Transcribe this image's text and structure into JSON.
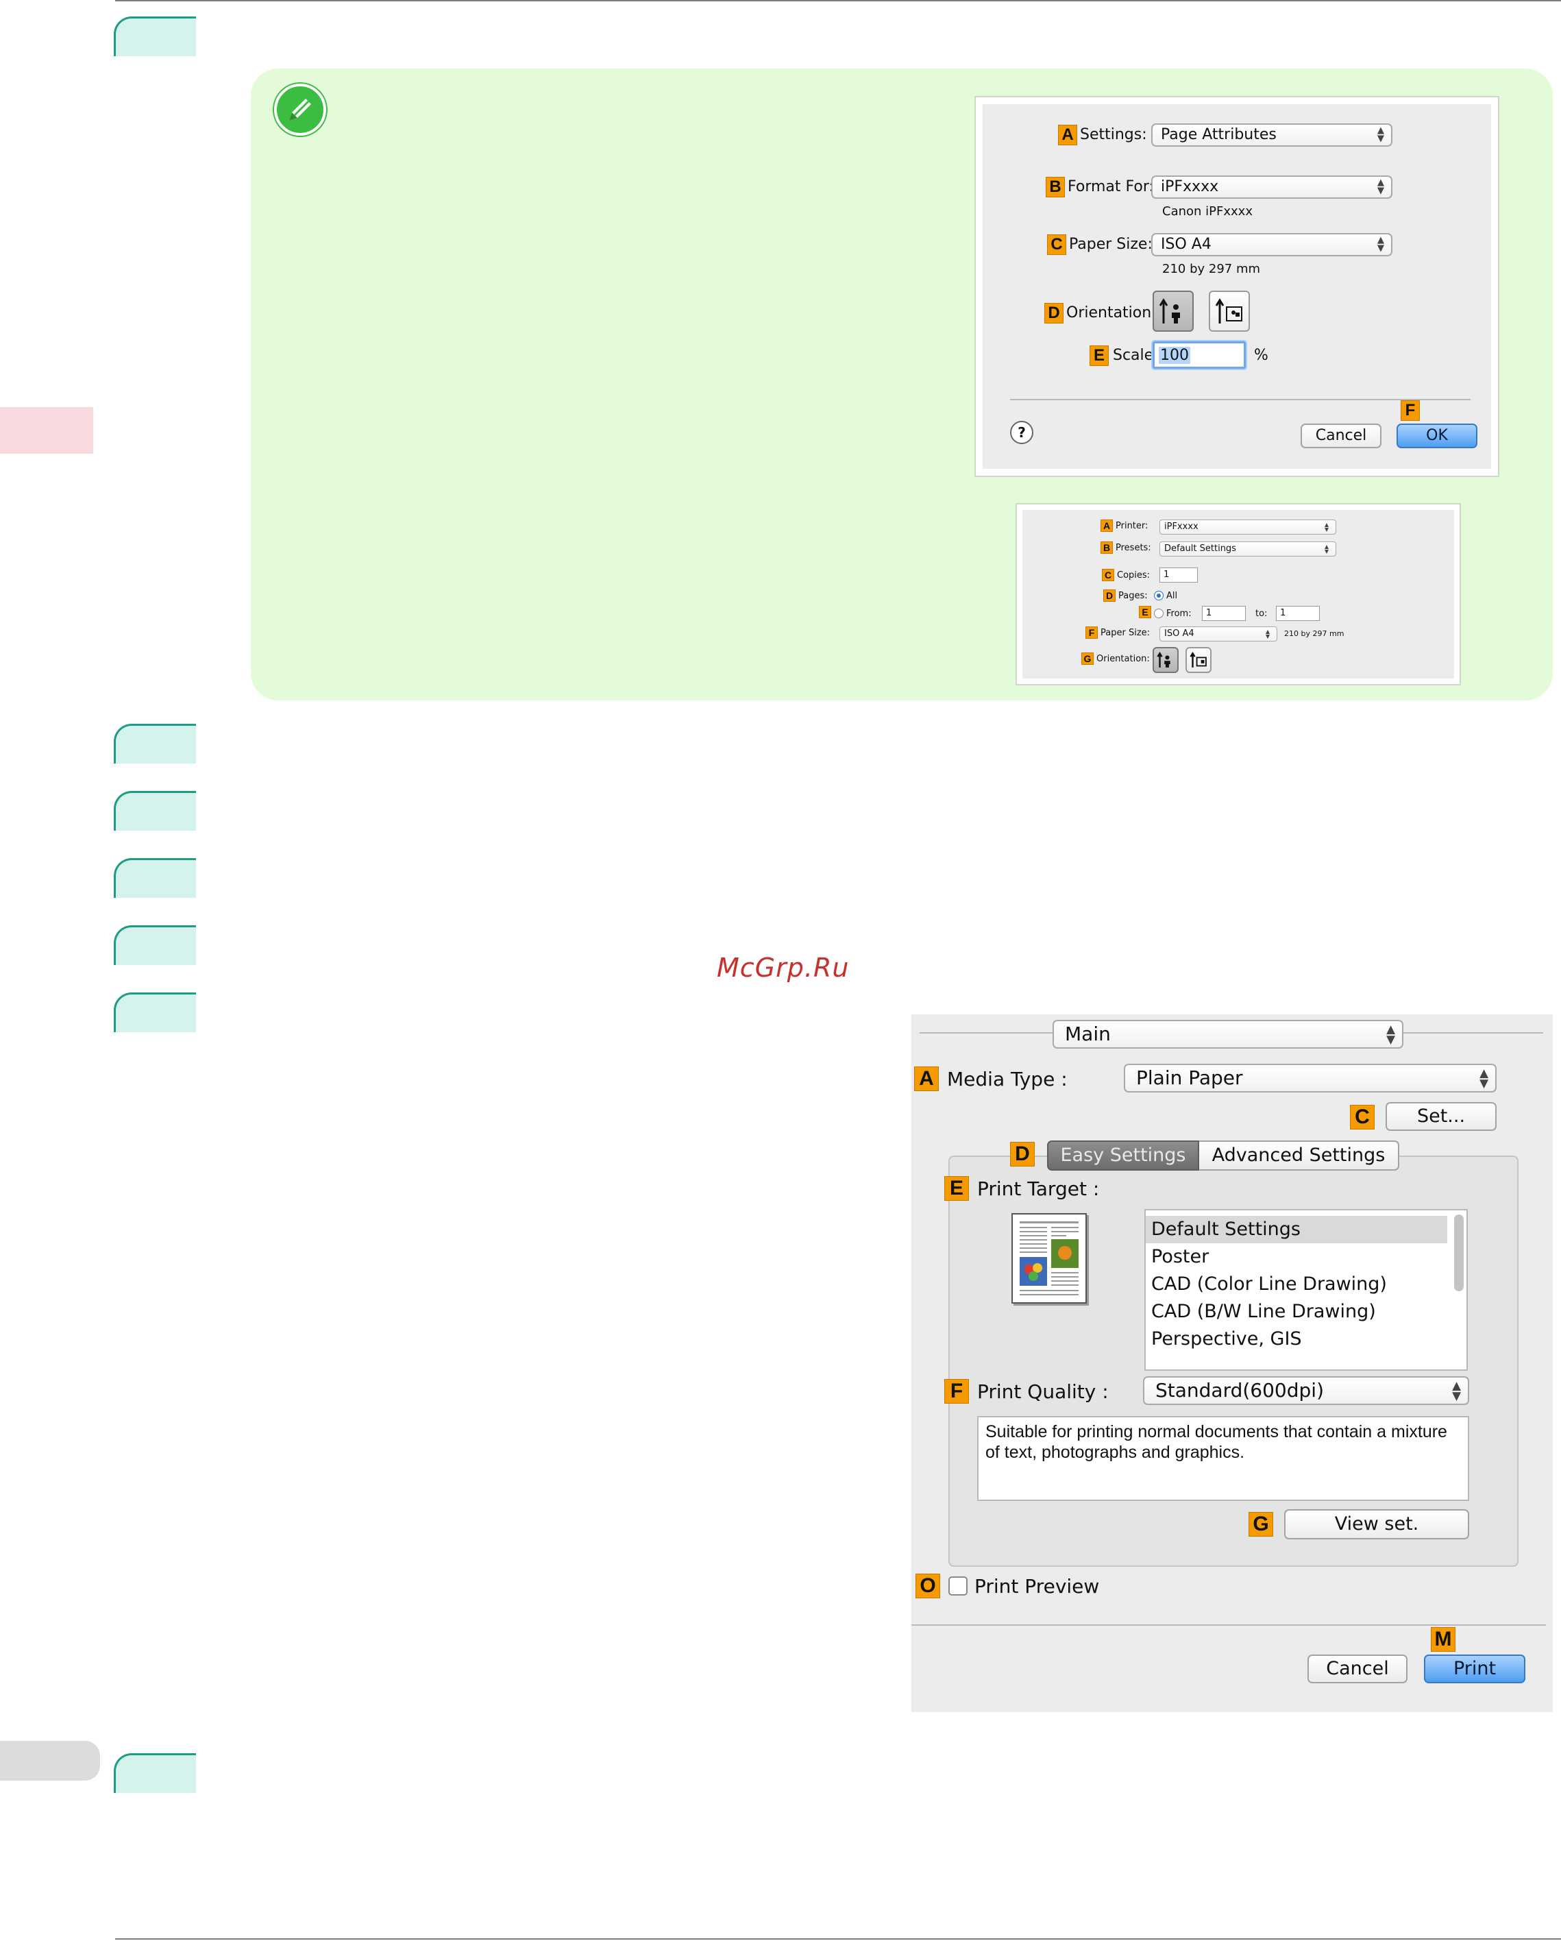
{
  "watermark": "McGrp.Ru",
  "page_setup_dialog": {
    "settings": {
      "key": "A",
      "label": "Settings:",
      "value": "Page Attributes"
    },
    "format_for": {
      "key": "B",
      "label": "Format For:",
      "value": "iPFxxxx",
      "sub": "Canon iPFxxxx"
    },
    "paper_size": {
      "key": "C",
      "label": "Paper Size:",
      "value": "ISO A4",
      "sub": "210 by 297 mm"
    },
    "orientation": {
      "key": "D",
      "label": "Orientation:"
    },
    "scale": {
      "key": "E",
      "label": "Scale:",
      "value": "100",
      "unit": "%"
    },
    "ok_key": "F",
    "help": "?",
    "cancel": "Cancel",
    "ok": "OK"
  },
  "print_dialog_small": {
    "printer": {
      "key": "A",
      "label": "Printer:",
      "value": "iPFxxxx"
    },
    "presets": {
      "key": "B",
      "label": "Presets:",
      "value": "Default Settings"
    },
    "copies": {
      "key": "C",
      "label": "Copies:",
      "value": "1"
    },
    "pages": {
      "key": "D",
      "label": "Pages:",
      "all": "All"
    },
    "from": {
      "key": "E",
      "label": "From:",
      "from_value": "1",
      "to_label": "to:",
      "to_value": "1"
    },
    "paper_size": {
      "key": "F",
      "label": "Paper Size:",
      "value": "ISO A4",
      "sub": "210 by 297 mm"
    },
    "orientation": {
      "key": "G",
      "label": "Orientation:"
    }
  },
  "print_main_dialog": {
    "panel": "Main",
    "media_type": {
      "key": "A",
      "label": "Media Type :",
      "value": "Plain Paper"
    },
    "set": {
      "key": "C",
      "label": "Set..."
    },
    "tabs_key": "D",
    "tabs": [
      "Easy Settings",
      "Advanced Settings"
    ],
    "print_target": {
      "key": "E",
      "label": "Print Target :",
      "items": [
        "Default Settings",
        "Poster",
        "CAD (Color Line Drawing)",
        "CAD (B/W Line Drawing)",
        "Perspective, GIS"
      ]
    },
    "print_quality": {
      "key": "F",
      "label": "Print Quality :",
      "value": "Standard(600dpi)"
    },
    "description": "Suitable for printing normal documents that contain a mixture of text, photographs and graphics.",
    "view_set": {
      "key": "G",
      "label": "View set."
    },
    "print_preview": {
      "key": "O",
      "label": "Print Preview"
    },
    "print_key": "M",
    "cancel": "Cancel",
    "print": "Print"
  }
}
